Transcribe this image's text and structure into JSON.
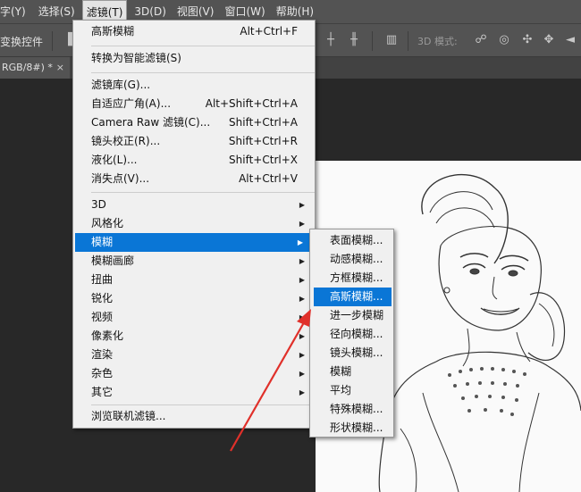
{
  "menubar": {
    "items": [
      {
        "label": "字(Y)"
      },
      {
        "label": "选择(S)"
      },
      {
        "label": "滤镜(T)",
        "active": true
      },
      {
        "label": "3D(D)"
      },
      {
        "label": "视图(V)"
      },
      {
        "label": "窗口(W)"
      },
      {
        "label": "帮助(H)"
      }
    ]
  },
  "options_bar": {
    "transform_label": "变换控件",
    "mode_label": "3D 模式:"
  },
  "document_tab": {
    "title": "RGB/8#) *",
    "close": "×"
  },
  "filter_menu": {
    "last_filter": {
      "label": "高斯模糊",
      "shortcut": "Alt+Ctrl+F"
    },
    "convert_smart": {
      "label": "转换为智能滤镜(S)"
    },
    "items_group1": [
      {
        "label": "滤镜库(G)...",
        "shortcut": ""
      },
      {
        "label": "自适应广角(A)...",
        "shortcut": "Alt+Shift+Ctrl+A"
      },
      {
        "label": "Camera Raw 滤镜(C)...",
        "shortcut": "Shift+Ctrl+A"
      },
      {
        "label": "镜头校正(R)...",
        "shortcut": "Shift+Ctrl+R"
      },
      {
        "label": "液化(L)...",
        "shortcut": "Shift+Ctrl+X"
      },
      {
        "label": "消失点(V)...",
        "shortcut": "Alt+Ctrl+V"
      }
    ],
    "submenus": [
      {
        "label": "3D"
      },
      {
        "label": "风格化"
      },
      {
        "label": "模糊",
        "highlighted": true
      },
      {
        "label": "模糊画廊"
      },
      {
        "label": "扭曲"
      },
      {
        "label": "锐化"
      },
      {
        "label": "视频"
      },
      {
        "label": "像素化"
      },
      {
        "label": "渲染"
      },
      {
        "label": "杂色"
      },
      {
        "label": "其它"
      }
    ],
    "browse_online": {
      "label": "浏览联机滤镜..."
    }
  },
  "blur_submenu": {
    "items": [
      {
        "label": "表面模糊..."
      },
      {
        "label": "动感模糊..."
      },
      {
        "label": "方框模糊..."
      },
      {
        "label": "高斯模糊...",
        "highlighted": true
      },
      {
        "label": "进一步模糊"
      },
      {
        "label": "径向模糊..."
      },
      {
        "label": "镜头模糊..."
      },
      {
        "label": "模糊"
      },
      {
        "label": "平均"
      },
      {
        "label": "特殊模糊..."
      },
      {
        "label": "形状模糊..."
      }
    ]
  },
  "colors": {
    "menubar_bg": "#535353",
    "menu_bg": "#f0f0f0",
    "highlight": "#0a76d6",
    "annotation_arrow": "#e0302a"
  }
}
